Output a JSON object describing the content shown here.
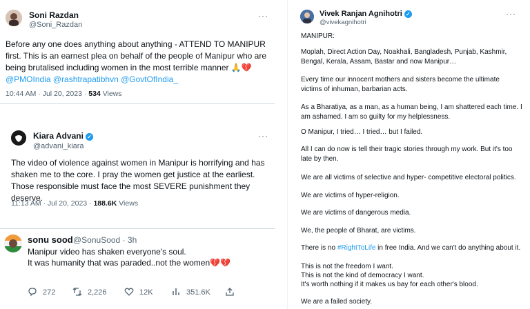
{
  "tweet1": {
    "name": "Soni Razdan",
    "handle": "@Soni_Razdan",
    "text": "Before any one does anything about anything - ATTEND TO MANIPUR first. This is an earnest plea on behalf of the people of Manipur who are being brutalised including women in the most terrible manner 🙏💔",
    "mentions": "@PMOIndia @rashtrapatibhvn @GovtOfIndia_",
    "time": "10:44 AM · Jul 20, 2023 · ",
    "views_count": "534",
    "views_label": " Views"
  },
  "tweet2": {
    "name": "Kiara Advani",
    "handle": "@advani_kiara",
    "text": "The video of violence against women in Manipur is horrifying and has shaken me to the core. I pray the women get justice at the earliest. Those responsible must face the most SEVERE punishment they deserve.",
    "time": "11:13 AM · Jul 20, 2023 · ",
    "views_count": "188.6K",
    "views_label": " Views"
  },
  "tweet3": {
    "name": "sonu sood",
    "handle": "@SonuSood · 3h",
    "line1": "Manipur video has shaken everyone's soul.",
    "line2": "It was humanity that was paraded..not the women💔💔",
    "replies": "272",
    "retweets": "2,226",
    "likes": "12K",
    "views": "351.6K"
  },
  "tweet4": {
    "name": "Vivek Ranjan Agnihotri",
    "handle": "@vivekagnihotri",
    "lines": [
      "MANIPUR:",
      "Moplah, Direct Action Day, Noakhali, Bangladesh, Punjab, Kashmir,",
      "Bengal, Kerala, Assam, Bastar and now Manipur…",
      "Every time our innocent mothers and sisters become the ultimate",
      "victims of inhuman, barbarian acts.",
      "As a Bharatiya, as a man, as a human being, I am shattered each time. I",
      "am ashamed. I am so guilty for my helplessness.",
      "O Manipur, I tried… I tried… but I failed.",
      "All I can do now is tell their tragic stories through my work. But it's too",
      "late by then.",
      "We are all victims of selective and hyper- competitive electoral politics.",
      "We are victims of hyper-religion.",
      "We are victims of dangerous media.",
      "We, the people of Bharat, are victims.",
      "This is not the freedom I want.",
      "This is not the kind of democracy I want.",
      "It's worth nothing if it makes us bay for each other's blood.",
      "We are a failed society."
    ],
    "hashtag_before": "There is no ",
    "hashtag": "#RightToLife",
    "hashtag_after": " in free India. And we can't do anything about it."
  },
  "more_label": "···"
}
